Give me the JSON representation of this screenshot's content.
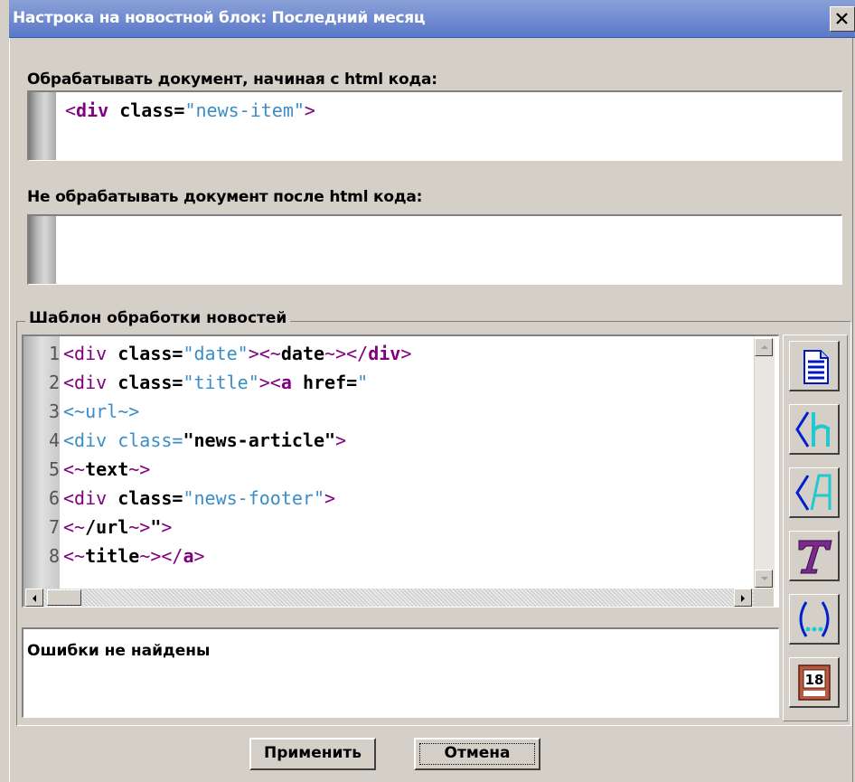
{
  "window": {
    "title": "Настрока на новостной блок: Последний месяц",
    "close_label": "×"
  },
  "start_section": {
    "label": "Обрабатывать документ, начиная с html кода:",
    "code": {
      "tag_open": "<",
      "tag": "div",
      "attr": " class=",
      "value": "\"news-item\"",
      "tag_close": ">"
    }
  },
  "stop_section": {
    "label": "Не обрабатывать документ после html кода:",
    "value": ""
  },
  "template": {
    "legend": "Шаблон обработки новостей",
    "lines": [
      {
        "num": "1"
      },
      {
        "num": "2"
      },
      {
        "num": "3"
      },
      {
        "num": "4"
      },
      {
        "num": "5"
      },
      {
        "num": "6"
      },
      {
        "num": "7"
      },
      {
        "num": "8"
      }
    ]
  },
  "errors": {
    "text": "Ошибки не найдены"
  },
  "toolbar": {
    "icons": [
      "document-icon",
      "insert-tag-h-icon",
      "insert-tag-a-icon",
      "text-format-icon",
      "parentheses-icon",
      "calendar-icon"
    ],
    "calendar_day": "18"
  },
  "buttons": {
    "apply": "Применить",
    "cancel": "Отмена"
  },
  "colors": {
    "titlebar": "#6a86cc",
    "tag": "#800080",
    "string": "#3a8dc8",
    "face": "#d4d0c8"
  }
}
